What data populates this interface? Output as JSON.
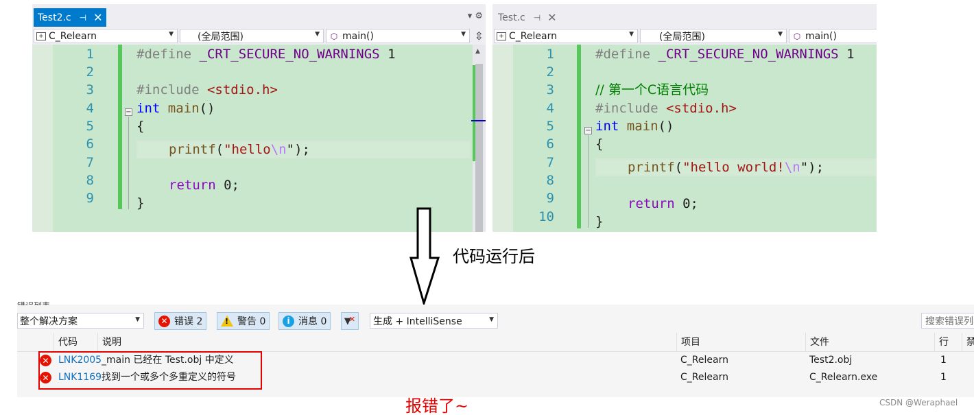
{
  "left_pane": {
    "tab": {
      "title": "Test2.c",
      "pin": "⊣",
      "close": "✕"
    },
    "tools": "▾  ⚙",
    "nav": {
      "project": "C_Relearn",
      "scope": "(全局范围)",
      "function": "main()"
    },
    "split": "⇳",
    "line_numbers": [
      "1",
      "2",
      "3",
      "4",
      "5",
      "6",
      "7",
      "8",
      "9"
    ],
    "code": {
      "l1_pre": "#define ",
      "l1_macro": "_CRT_SECURE_NO_WARNINGS",
      "l1_val": " 1",
      "l3_pre": "#include ",
      "l3_hdr": "<stdio.h>",
      "l4_kw": "int",
      "l4_fn": " main",
      "l4_rest": "()",
      "l5": "{",
      "l6_fn": "printf",
      "l6_open": "(",
      "l6_str": "\"hello",
      "l6_esc": "\\n",
      "l6_close": "\");",
      "l8_kw": "return",
      "l8_num": " 0",
      "l8_rest": ";",
      "l9": "}"
    }
  },
  "right_pane": {
    "tab": {
      "title": "Test.c",
      "pin": "⊣",
      "close": "✕"
    },
    "nav": {
      "project": "C_Relearn",
      "scope": "(全局范围)",
      "function": "main()"
    },
    "line_numbers": [
      "1",
      "2",
      "3",
      "4",
      "5",
      "6",
      "7",
      "8",
      "9",
      "10"
    ],
    "code": {
      "l1_pre": "#define ",
      "l1_macro": "_CRT_SECURE_NO_WARNINGS",
      "l1_val": " 1",
      "l3_comment": "// 第一个C语言代码",
      "l4_pre": "#include ",
      "l4_hdr": "<stdio.h>",
      "l5_kw": "int",
      "l5_fn": " main",
      "l5_rest": "()",
      "l6": "{",
      "l7_fn": "printf",
      "l7_open": "(",
      "l7_str": "\"hello world!",
      "l7_esc": "\\n",
      "l7_close": "\");",
      "l9_kw": "return",
      "l9_num": " 0",
      "l9_rest": ";",
      "l10": "}"
    }
  },
  "caption_run": "代码运行后",
  "error_list": {
    "cut_title": "错误列表",
    "scope": "整个解决方案",
    "errors_btn": "错误 2",
    "warnings_btn": "警告 0",
    "messages_btn": "消息 0",
    "build_filter": "生成 + IntelliSense",
    "search_placeholder": "搜索错误列表",
    "columns": {
      "code": "代码",
      "desc": "说明",
      "project": "项目",
      "file": "文件",
      "line": "行",
      "suppress": "禁"
    },
    "rows": [
      {
        "code": "LNK2005",
        "desc": "_main 已经在 Test.obj 中定义",
        "project": "C_Relearn",
        "file": "Test2.obj",
        "line": "1"
      },
      {
        "code": "LNK1169",
        "desc": "找到一个或多个多重定义的符号",
        "project": "C_Relearn",
        "file": "C_Relearn.exe",
        "line": "1"
      }
    ]
  },
  "caption_error": "报错了~",
  "watermark": "CSDN @Weraphael",
  "colors": {
    "tab_active": "#007acc",
    "editor_bg": "#c9e7cc",
    "error_red": "#e51400",
    "highlight_red": "#e60000"
  }
}
